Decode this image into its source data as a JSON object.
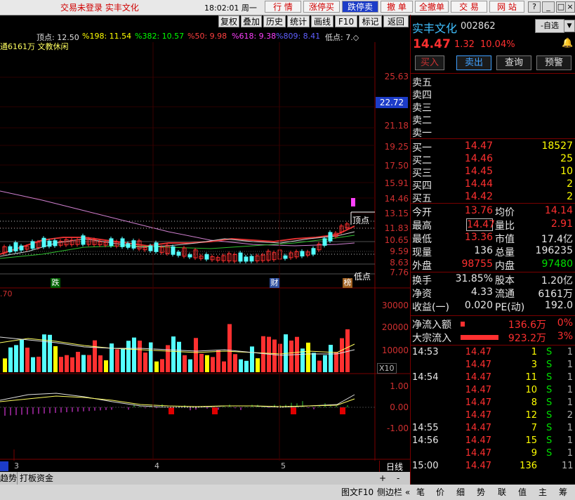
{
  "titlebar": {
    "login_status": "交易未登录  实丰文化",
    "clock": "18:02:01 周一",
    "buttons": [
      "行 情",
      "涨停买",
      "跌停卖",
      "撤 单",
      "全撤单",
      "交 易",
      "网 站"
    ],
    "window_controls": [
      "?",
      "_",
      "□",
      "×"
    ]
  },
  "toolbar": {
    "buttons": [
      "复权",
      "叠加",
      "历史",
      "统计",
      "画线",
      "F10",
      "标记",
      "返回"
    ]
  },
  "chart": {
    "ma_line": {
      "top": "顶点: 12.50",
      "p198": "%198: 11.54",
      "p382": "%382: 10.57",
      "p50": "%50: 9.98",
      "p618": "%618: 9.38",
      "p809": "%809: 8.41",
      "low": "低点: 7.◇"
    },
    "info_line": "通6161万 文教休闲",
    "price_labels": [
      "25.63",
      "22.72",
      "21.18",
      "19.25",
      "17.50",
      "15.91",
      "14.46",
      "13.15",
      "11.83",
      "10.65",
      "9.59",
      "8.63",
      "7.76"
    ],
    "current_price_tag": "22.72",
    "annotations": {
      "top_point": "顶点",
      "low_point": "低点",
      "mark_fall": "跌",
      "mark_cai": "财",
      "mark_bang": "榜"
    },
    "volume_labels": [
      "30000",
      "20000",
      "10000"
    ],
    "volume_unit": "X10",
    "volume_axis_top": ".70",
    "macd_labels": [
      "1.00",
      "0.00",
      "-1.00"
    ],
    "month_labels": [
      "3",
      "4",
      "5"
    ],
    "period": "日线"
  },
  "bottom_tabs": [
    "趋势",
    "打板资金"
  ],
  "bottom_controls": [
    "+",
    "-"
  ],
  "stock": {
    "name": "实丰文化",
    "code": "002862",
    "selfselect": "-自选",
    "price": "14.47",
    "change": "1.32",
    "change_pct": "10.04%",
    "actions": [
      "买入",
      "卖出",
      "查询",
      "预警"
    ]
  },
  "sell_book": [
    {
      "label": "卖五",
      "price": "",
      "vol": ""
    },
    {
      "label": "卖四",
      "price": "",
      "vol": ""
    },
    {
      "label": "卖三",
      "price": "",
      "vol": ""
    },
    {
      "label": "卖二",
      "price": "",
      "vol": ""
    },
    {
      "label": "卖一",
      "price": "",
      "vol": ""
    }
  ],
  "buy_book": [
    {
      "label": "买一",
      "price": "14.47",
      "vol": "18527"
    },
    {
      "label": "买二",
      "price": "14.46",
      "vol": "25"
    },
    {
      "label": "买三",
      "price": "14.45",
      "vol": "10"
    },
    {
      "label": "买四",
      "price": "14.44",
      "vol": "2"
    },
    {
      "label": "买五",
      "price": "14.42",
      "vol": "2"
    }
  ],
  "stats": [
    {
      "k1": "今开",
      "v1": "13.76",
      "c1": "red",
      "k2": "均价",
      "v2": "14.14",
      "c2": "red"
    },
    {
      "k1": "最高",
      "v1": "14.47",
      "c1": "red",
      "k2": "量比",
      "v2": "2.91",
      "c2": "red"
    },
    {
      "k1": "最低",
      "v1": "13.36",
      "c1": "red",
      "k2": "市值",
      "v2": "17.4亿",
      "c2": "wht"
    },
    {
      "k1": "现量",
      "v1": "136",
      "c1": "wht",
      "k2": "总量",
      "v2": "196235",
      "c2": "wht"
    },
    {
      "k1": "外盘",
      "v1": "98755",
      "c1": "red",
      "k2": "内盘",
      "v2": "97480",
      "c2": "green"
    }
  ],
  "stats2": [
    {
      "k1": "换手",
      "v1": "31.85%",
      "k2": "股本",
      "v2": "1.20亿"
    },
    {
      "k1": "净资",
      "v1": "4.33",
      "k2": "流通",
      "v2": "6161万"
    },
    {
      "k1": "收益(一)",
      "v1": "0.020",
      "k2": "PE(动)",
      "v2": "192.0"
    }
  ],
  "flows": [
    {
      "label": "净流入额",
      "value": "136.6万",
      "pct": "0%"
    },
    {
      "label": "大宗流入",
      "value": "923.2万",
      "pct": "3%"
    }
  ],
  "ticks": [
    {
      "time": "14:53",
      "price": "14.47",
      "vol": "1",
      "side": "S",
      "n": "1"
    },
    {
      "time": "",
      "price": "14.47",
      "vol": "3",
      "side": "S",
      "n": "1"
    },
    {
      "time": "14:54",
      "price": "14.47",
      "vol": "11",
      "side": "S",
      "n": "1"
    },
    {
      "time": "",
      "price": "14.47",
      "vol": "10",
      "side": "S",
      "n": "1"
    },
    {
      "time": "",
      "price": "14.47",
      "vol": "8",
      "side": "S",
      "n": "1"
    },
    {
      "time": "",
      "price": "14.47",
      "vol": "12",
      "side": "S",
      "n": "2"
    },
    {
      "time": "14:55",
      "price": "14.47",
      "vol": "7",
      "side": "S",
      "n": "1"
    },
    {
      "time": "14:56",
      "price": "14.47",
      "vol": "15",
      "side": "S",
      "n": "1"
    },
    {
      "time": "",
      "price": "14.47",
      "vol": "9",
      "side": "S",
      "n": "1"
    },
    {
      "time": "15:00",
      "price": "14.47",
      "vol": "136",
      "side": "",
      "n": "11"
    }
  ],
  "status_tabs": [
    "图文F10",
    "侧边栏 «",
    "笔",
    "价",
    "细",
    "势",
    "联",
    "值",
    "主",
    "筹"
  ],
  "colors": {
    "up": "#ff3030",
    "down": "#00e000",
    "cyan": "#54ffff",
    "yellow": "#ffff00"
  }
}
